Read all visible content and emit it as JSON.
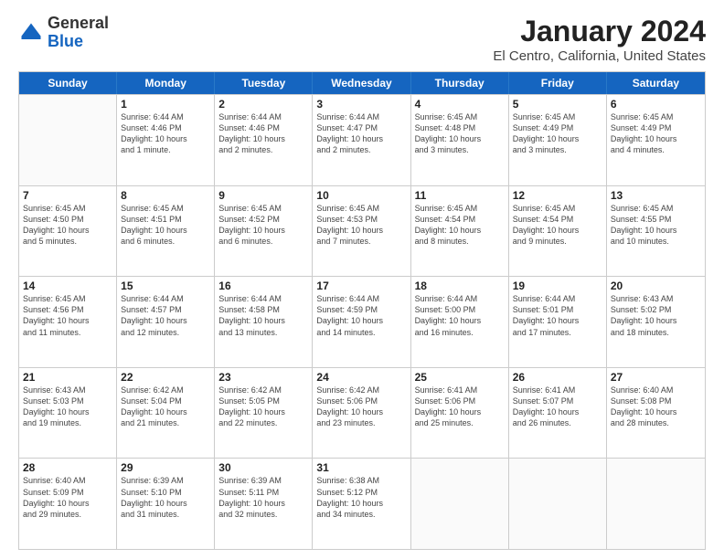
{
  "logo": {
    "general": "General",
    "blue": "Blue"
  },
  "title": "January 2024",
  "subtitle": "El Centro, California, United States",
  "header_days": [
    "Sunday",
    "Monday",
    "Tuesday",
    "Wednesday",
    "Thursday",
    "Friday",
    "Saturday"
  ],
  "weeks": [
    [
      {
        "day": "",
        "info": ""
      },
      {
        "day": "1",
        "info": "Sunrise: 6:44 AM\nSunset: 4:46 PM\nDaylight: 10 hours\nand 1 minute."
      },
      {
        "day": "2",
        "info": "Sunrise: 6:44 AM\nSunset: 4:46 PM\nDaylight: 10 hours\nand 2 minutes."
      },
      {
        "day": "3",
        "info": "Sunrise: 6:44 AM\nSunset: 4:47 PM\nDaylight: 10 hours\nand 2 minutes."
      },
      {
        "day": "4",
        "info": "Sunrise: 6:45 AM\nSunset: 4:48 PM\nDaylight: 10 hours\nand 3 minutes."
      },
      {
        "day": "5",
        "info": "Sunrise: 6:45 AM\nSunset: 4:49 PM\nDaylight: 10 hours\nand 3 minutes."
      },
      {
        "day": "6",
        "info": "Sunrise: 6:45 AM\nSunset: 4:49 PM\nDaylight: 10 hours\nand 4 minutes."
      }
    ],
    [
      {
        "day": "7",
        "info": "Sunrise: 6:45 AM\nSunset: 4:50 PM\nDaylight: 10 hours\nand 5 minutes."
      },
      {
        "day": "8",
        "info": "Sunrise: 6:45 AM\nSunset: 4:51 PM\nDaylight: 10 hours\nand 6 minutes."
      },
      {
        "day": "9",
        "info": "Sunrise: 6:45 AM\nSunset: 4:52 PM\nDaylight: 10 hours\nand 6 minutes."
      },
      {
        "day": "10",
        "info": "Sunrise: 6:45 AM\nSunset: 4:53 PM\nDaylight: 10 hours\nand 7 minutes."
      },
      {
        "day": "11",
        "info": "Sunrise: 6:45 AM\nSunset: 4:54 PM\nDaylight: 10 hours\nand 8 minutes."
      },
      {
        "day": "12",
        "info": "Sunrise: 6:45 AM\nSunset: 4:54 PM\nDaylight: 10 hours\nand 9 minutes."
      },
      {
        "day": "13",
        "info": "Sunrise: 6:45 AM\nSunset: 4:55 PM\nDaylight: 10 hours\nand 10 minutes."
      }
    ],
    [
      {
        "day": "14",
        "info": "Sunrise: 6:45 AM\nSunset: 4:56 PM\nDaylight: 10 hours\nand 11 minutes."
      },
      {
        "day": "15",
        "info": "Sunrise: 6:44 AM\nSunset: 4:57 PM\nDaylight: 10 hours\nand 12 minutes."
      },
      {
        "day": "16",
        "info": "Sunrise: 6:44 AM\nSunset: 4:58 PM\nDaylight: 10 hours\nand 13 minutes."
      },
      {
        "day": "17",
        "info": "Sunrise: 6:44 AM\nSunset: 4:59 PM\nDaylight: 10 hours\nand 14 minutes."
      },
      {
        "day": "18",
        "info": "Sunrise: 6:44 AM\nSunset: 5:00 PM\nDaylight: 10 hours\nand 16 minutes."
      },
      {
        "day": "19",
        "info": "Sunrise: 6:44 AM\nSunset: 5:01 PM\nDaylight: 10 hours\nand 17 minutes."
      },
      {
        "day": "20",
        "info": "Sunrise: 6:43 AM\nSunset: 5:02 PM\nDaylight: 10 hours\nand 18 minutes."
      }
    ],
    [
      {
        "day": "21",
        "info": "Sunrise: 6:43 AM\nSunset: 5:03 PM\nDaylight: 10 hours\nand 19 minutes."
      },
      {
        "day": "22",
        "info": "Sunrise: 6:42 AM\nSunset: 5:04 PM\nDaylight: 10 hours\nand 21 minutes."
      },
      {
        "day": "23",
        "info": "Sunrise: 6:42 AM\nSunset: 5:05 PM\nDaylight: 10 hours\nand 22 minutes."
      },
      {
        "day": "24",
        "info": "Sunrise: 6:42 AM\nSunset: 5:06 PM\nDaylight: 10 hours\nand 23 minutes."
      },
      {
        "day": "25",
        "info": "Sunrise: 6:41 AM\nSunset: 5:06 PM\nDaylight: 10 hours\nand 25 minutes."
      },
      {
        "day": "26",
        "info": "Sunrise: 6:41 AM\nSunset: 5:07 PM\nDaylight: 10 hours\nand 26 minutes."
      },
      {
        "day": "27",
        "info": "Sunrise: 6:40 AM\nSunset: 5:08 PM\nDaylight: 10 hours\nand 28 minutes."
      }
    ],
    [
      {
        "day": "28",
        "info": "Sunrise: 6:40 AM\nSunset: 5:09 PM\nDaylight: 10 hours\nand 29 minutes."
      },
      {
        "day": "29",
        "info": "Sunrise: 6:39 AM\nSunset: 5:10 PM\nDaylight: 10 hours\nand 31 minutes."
      },
      {
        "day": "30",
        "info": "Sunrise: 6:39 AM\nSunset: 5:11 PM\nDaylight: 10 hours\nand 32 minutes."
      },
      {
        "day": "31",
        "info": "Sunrise: 6:38 AM\nSunset: 5:12 PM\nDaylight: 10 hours\nand 34 minutes."
      },
      {
        "day": "",
        "info": ""
      },
      {
        "day": "",
        "info": ""
      },
      {
        "day": "",
        "info": ""
      }
    ]
  ]
}
